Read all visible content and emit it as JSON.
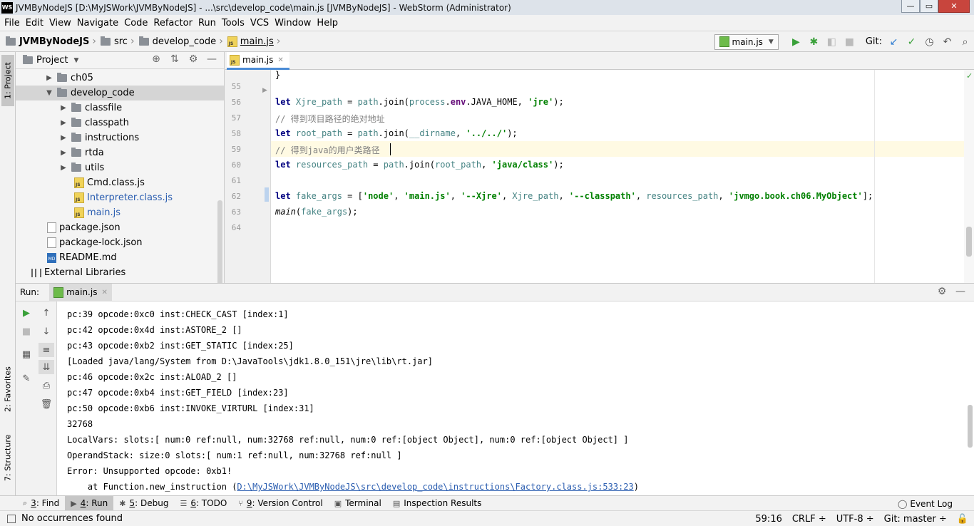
{
  "window": {
    "app_icon": "WS",
    "title": "JVMByNodeJS [D:\\MyJSWork\\JVMByNodeJS] - ...\\src\\develop_code\\main.js [JVMByNodeJS] - WebStorm (Administrator)",
    "minimize": "—",
    "maximize": "▭",
    "close": "✕"
  },
  "menu": [
    "File",
    "Edit",
    "View",
    "Navigate",
    "Code",
    "Refactor",
    "Run",
    "Tools",
    "VCS",
    "Window",
    "Help"
  ],
  "breadcrumb": {
    "project": "JVMByNodeJS",
    "src": "src",
    "develop_code": "develop_code",
    "file": "main.js"
  },
  "toolbar": {
    "run_config": "main.js",
    "git_label": "Git:"
  },
  "left_stripe": {
    "project_tab": "1: Project",
    "favorites_tab": "2: Favorites",
    "structure_tab": "7: Structure"
  },
  "project_panel": {
    "title": "Project",
    "tree": [
      {
        "label": "ch05",
        "type": "folder"
      },
      {
        "label": "develop_code",
        "type": "folder"
      },
      {
        "label": "classfile",
        "type": "folder"
      },
      {
        "label": "classpath",
        "type": "folder"
      },
      {
        "label": "instructions",
        "type": "folder"
      },
      {
        "label": "rtda",
        "type": "folder"
      },
      {
        "label": "utils",
        "type": "folder"
      },
      {
        "label": "Cmd.class.js",
        "type": "js"
      },
      {
        "label": "Interpreter.class.js",
        "type": "js"
      },
      {
        "label": "main.js",
        "type": "js"
      },
      {
        "label": "package.json",
        "type": "json"
      },
      {
        "label": "package-lock.json",
        "type": "json"
      },
      {
        "label": "README.md",
        "type": "md"
      },
      {
        "label": "External Libraries",
        "type": "lib"
      }
    ]
  },
  "editor": {
    "tab": "main.js",
    "js_badge": "JS",
    "lines": {
      "l55": "55",
      "l56": "56",
      "l57": "57",
      "l58": "58",
      "l59": "59",
      "l60": "60",
      "l61": "61",
      "l62": "62",
      "l63": "63",
      "l64": "64"
    },
    "code": {
      "let": "let",
      "xjre_var": "Xjre_path",
      "eq": " = ",
      "path": "path",
      "join_open": ".join(",
      "process": "process",
      "dot": ".",
      "env": "env",
      "java_home": ".JAVA_HOME, ",
      "jre_str": "'jre'",
      "close_semi": ");",
      "comment1": "// 得到项目路径的绝对地址",
      "root_var": "root_path",
      "dirname": "__dirname",
      "comma": ", ",
      "up_str": "'../../'",
      "comment2": "// 得到java的用户类路径",
      "res_var": "resources_path",
      "root_ref": "root_path",
      "javaclass_str": "'java/class'",
      "fake_var": "fake_args",
      "open_bracket": " = [",
      "node_str": "'node'",
      "mainjs_str": "'main.js'",
      "xjre_str": "'--Xjre'",
      "xjre_ref": "Xjre_path",
      "cp_str": "'--classpath'",
      "res_ref": "resources_path",
      "obj_str": "'jvmgo.book.ch06.MyObject'",
      "close_bracket": "];",
      "main_fn": "main",
      "paren_open": "(",
      "fake_ref": "fake_args"
    }
  },
  "run_panel": {
    "label": "Run:",
    "tab": "main.js",
    "console": [
      "pc:39 opcode:0xc0 inst:CHECK_CAST [index:1]",
      "pc:42 opcode:0x4d inst:ASTORE_2 []",
      "pc:43 opcode:0xb2 inst:GET_STATIC [index:25]",
      "[Loaded java/lang/System from D:\\JavaTools\\jdk1.8.0_151\\jre\\lib\\rt.jar]",
      "pc:46 opcode:0x2c inst:ALOAD_2 []",
      "pc:47 opcode:0xb4 inst:GET_FIELD [index:23]",
      "pc:50 opcode:0xb6 inst:INVOKE_VIRTURL [index:31]",
      "32768",
      "LocalVars: slots:[ num:0 ref:null, num:32768 ref:null, num:0 ref:[object Object], num:0 ref:[object Object] ]",
      "OperandStack: size:0 slots:[ num:1 ref:null, num:32768 ref:null ]",
      "Error: Unsupported opcode: 0xb1!"
    ],
    "stack_prefix": "    at Function.new_instruction (",
    "stack_link": "D:\\MyJSWork\\JVMByNodeJS\\src\\develop_code\\instructions\\Factory.class.js:533:23",
    "stack_suffix": ")"
  },
  "bottom_tabs": [
    {
      "num": "3",
      "label": ": Find"
    },
    {
      "num": "4",
      "label": ": Run"
    },
    {
      "num": "5",
      "label": ": Debug"
    },
    {
      "num": "6",
      "label": ": TODO"
    },
    {
      "num": "9",
      "label": ": Version Control"
    },
    {
      "num": "",
      "label": "Terminal"
    },
    {
      "num": "",
      "label": "Inspection Results"
    }
  ],
  "event_log": "Event Log",
  "status": {
    "message": "No occurrences found",
    "position": "59:16",
    "line_sep": "CRLF ÷",
    "encoding": "UTF-8 ÷",
    "git_branch": "Git: master ÷"
  },
  "colors": {
    "keyword": "#000080",
    "string": "#008000",
    "comment": "#808080",
    "variable": "#458383",
    "link": "#2a5db0",
    "run_green": "#3aa13a"
  }
}
